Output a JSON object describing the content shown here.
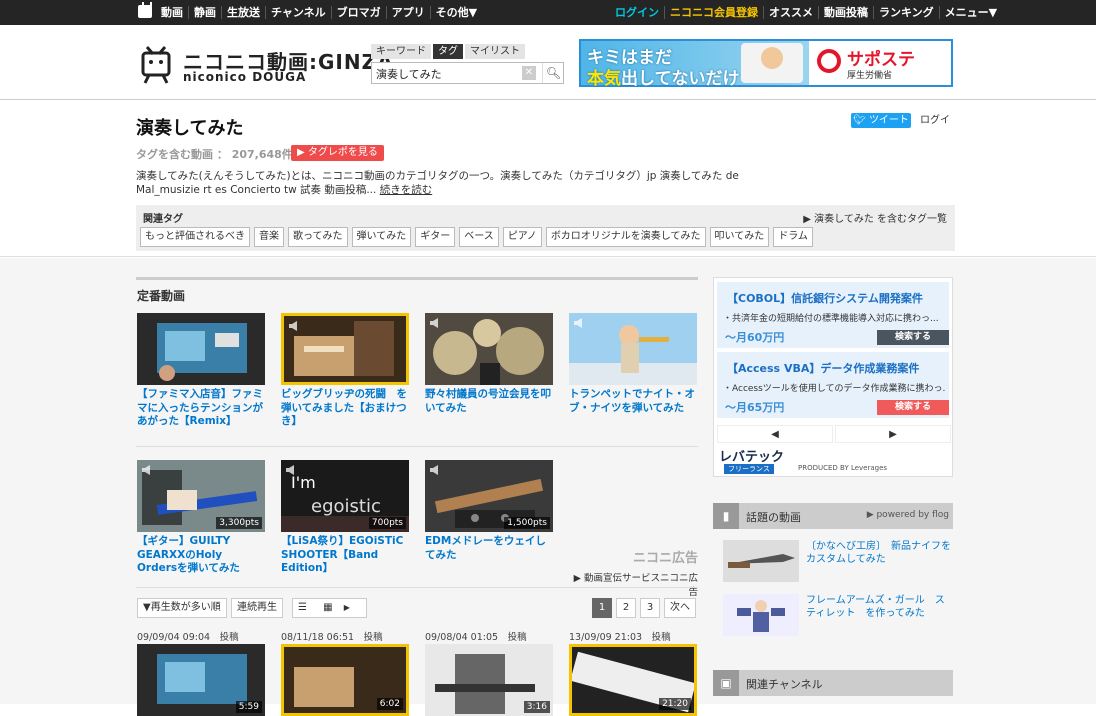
{
  "topnav": {
    "left": [
      "動画",
      "静画",
      "生放送",
      "チャンネル",
      "ブロマガ",
      "アプリ",
      "その他▼"
    ],
    "login": "ログイン",
    "register": "ニコニコ会員登録",
    "right": [
      "オススメ",
      "動画投稿",
      "ランキング",
      "メニュー▼"
    ]
  },
  "logo": {
    "main": "ニコニコ動画:GINZA",
    "sub": "niconico DOUGA"
  },
  "search": {
    "tabs": [
      "キーワード",
      "タグ",
      "マイリスト"
    ],
    "active_tab": "タグ",
    "value": "演奏してみた"
  },
  "banner": {
    "line1": "キミはまだ",
    "line2a": "本気",
    "line2b": "出してないだけ",
    "brand": "サポステ",
    "brand_sub": "厚生労働省"
  },
  "page": {
    "title": "演奏してみた",
    "tweet": "ツイート",
    "login": "ログイ",
    "count_label": "タグを含む動画 ：",
    "count": "207,648件",
    "tagrepo": "▶ タグレポを見る",
    "description": "演奏してみた(えんそうしてみた)とは、ニコニコ動画のカテゴリタグの一つ。演奏してみた（カテゴリタグ）jp 演奏してみた de Mal_musizie rt es Concierto tw 試奏 動画投稿...",
    "more": "続きを読む"
  },
  "related_tags": {
    "label": "関連タグ",
    "link": "▶ 演奏してみた を含むタグ一覧",
    "tags": [
      "もっと評価されるべき",
      "音楽",
      "歌ってみた",
      "弾いてみた",
      "ギター",
      "ベース",
      "ピアノ",
      "ボカロオリジナルを演奏してみた",
      "叩いてみた",
      "ドラム"
    ]
  },
  "teiban": {
    "heading": "定番動画",
    "videos": [
      {
        "title": "【ファミマ入店音】ファミマに入ったらテンションがあがった【Remix】"
      },
      {
        "title": "ビッグブリッヂの死闘　を弾いてみました【おまけつき】"
      },
      {
        "title": "野々村議員の号泣会見を叩いてみた"
      },
      {
        "title": "トランペットでナイト・オブ・ナイツを弾いてみた"
      },
      {
        "title": "【ギター】GUILTY GEARXXのHoly Ordersを弾いてみた",
        "pts": "3,300pts"
      },
      {
        "title": "【LiSA祭り】EGOiSTiC SHOOTER【Band Edition】",
        "pts": "700pts"
      },
      {
        "title": "EDMメドレーをウェイしてみた",
        "pts": "1,500pts"
      }
    ]
  },
  "ad_note": {
    "logo": "ニコニ広告",
    "text": "▶ 動画宣伝サービスニコニ広告"
  },
  "sort": {
    "order": "▼再生数が多い順",
    "continuous": "連続再生",
    "pages": [
      "1",
      "2",
      "3"
    ],
    "next": "次へ"
  },
  "list_dates": [
    "09/09/04 09:04　投稿",
    "08/11/18 06:51　投稿",
    "09/08/04 01:05　投稿",
    "13/09/09 21:03　投稿"
  ],
  "list_durations": [
    "5:59",
    "6:02",
    "3:16",
    "21:20"
  ],
  "side_ad": {
    "jobs": [
      {
        "title": "【COBOL】信託銀行システム開発案件",
        "desc": "・共済年金の短期給付の標準機能導入対応に携わっ...",
        "salary": "〜月60万円",
        "button": "検索する"
      },
      {
        "title": "【Access VBA】データ作成業務案件",
        "desc": "・Accessツールを使用してのデータ作成業務に携わっ...",
        "salary": "〜月65万円",
        "button": "検索する"
      }
    ],
    "prev": "◀",
    "next": "▶",
    "brand": "レバテック",
    "brand_sub": "フリーランス",
    "produced": "PRODUCED BY Leverages"
  },
  "topics": {
    "heading": "話題の動画",
    "powered": "▶ powered by flog",
    "items": [
      {
        "title": "〔かなへび工房〕　新品ナイフをカスタムしてみた"
      },
      {
        "title": "フレームアームズ・ガール　スティレット　を作ってみた"
      }
    ]
  },
  "channel": {
    "heading": "関連チャンネル"
  },
  "colors": {
    "topbar": "#252525",
    "link": "#0077cc",
    "accent_red": "#f04b4b",
    "gold": "#f5c400"
  }
}
